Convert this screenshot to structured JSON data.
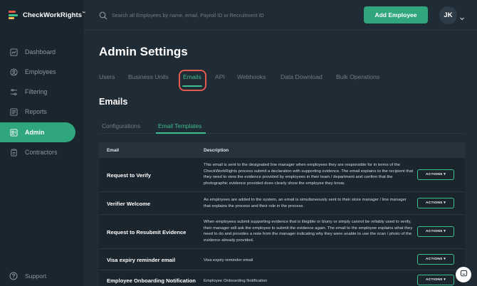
{
  "brand": {
    "name": "CheckWorkRights",
    "tm": "™"
  },
  "sidebar": {
    "items": [
      {
        "label": "Dashboard",
        "icon": "chart-icon"
      },
      {
        "label": "Employees",
        "icon": "user-icon"
      },
      {
        "label": "Filtering",
        "icon": "filter-icon"
      },
      {
        "label": "Reports",
        "icon": "report-icon"
      },
      {
        "label": "Admin",
        "icon": "admin-icon",
        "active": true
      },
      {
        "label": "Contractors",
        "icon": "contractor-icon"
      }
    ],
    "support_label": "Support"
  },
  "topbar": {
    "search_placeholder": "Search all Employees by name, email, Payroll ID or Recruitment ID",
    "add_employee_label": "Add Employee",
    "avatar_initials": "JK"
  },
  "page": {
    "title": "Admin Settings",
    "tabs": [
      "Users",
      "Business Units",
      "Emails",
      "API",
      "Webhooks",
      "Data Download",
      "Bulk Operations"
    ],
    "active_tab": "Emails",
    "section_title": "Emails",
    "subtabs": [
      "Configurations",
      "Email Templates"
    ],
    "active_subtab": "Email Templates"
  },
  "table": {
    "headers": {
      "email": "Email",
      "description": "Description"
    },
    "action_label": "ACTIONS ▾",
    "rows": [
      {
        "name": "Request to Verify",
        "description": "This email is sent to the designated line manager when employees they are responsible for in terms of the CheckWorkRights process submit a declaration with supporting evidence. The email explains to the recipient that they need to view the evidence provided by employees in their team / department and confirm that the photographic evidence provided does clearly show the employee they know."
      },
      {
        "name": "Verifier Welcome",
        "description": "As employees are added to the system, an email is simultaneously sent to their store manager / line manager that explains the process and their role in the process."
      },
      {
        "name": "Request to Resubmit Evidence",
        "description": "When employees submit supporting evidence that is illegible or blurry or simply cannot be reliably used to verify, their manager will ask the employee to submit the evidence again. The email to the employee explains what they need to do and provides a note from the manager indicating why they were unable to use the scan / photo of the evidence already provided."
      },
      {
        "name": "Visa expiry reminder email",
        "description": "Visa expiry reminder email"
      },
      {
        "name": "Employee Onboarding Notification",
        "description": "Employee Onboarding Notification"
      }
    ]
  },
  "colors": {
    "accent": "#2fa67b",
    "highlight": "#e25a52",
    "background": "#1f2b35"
  }
}
